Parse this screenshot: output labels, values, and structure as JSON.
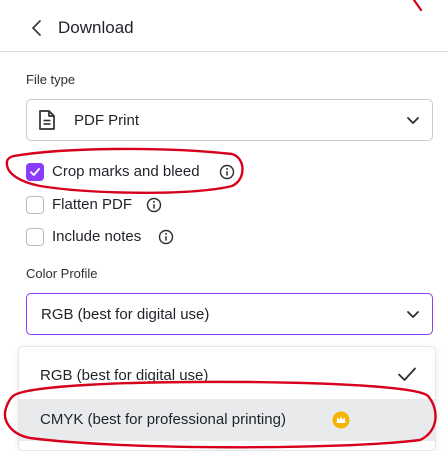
{
  "header": {
    "title": "Download"
  },
  "file_type": {
    "label": "File type",
    "selected": "PDF Print"
  },
  "options": [
    {
      "label": "Crop marks and bleed",
      "checked": true
    },
    {
      "label": "Flatten PDF",
      "checked": false
    },
    {
      "label": "Include notes",
      "checked": false
    }
  ],
  "color_profile": {
    "label": "Color Profile",
    "selected": "RGB (best for digital use)",
    "menu": [
      {
        "label": "RGB (best for digital use)",
        "selected": true
      },
      {
        "label": "CMYK (best for professional printing)",
        "pro": true
      }
    ]
  },
  "colors": {
    "accent": "#8b3dff",
    "annotation": "#d6001c",
    "pro_badge": "#f5b400"
  },
  "icons": {
    "back": "chevron-left-icon",
    "file_type": "document-icon",
    "dropdown": "chevron-down-icon",
    "info": "info-icon",
    "selected": "checkmark-icon",
    "pro": "crown-icon"
  }
}
